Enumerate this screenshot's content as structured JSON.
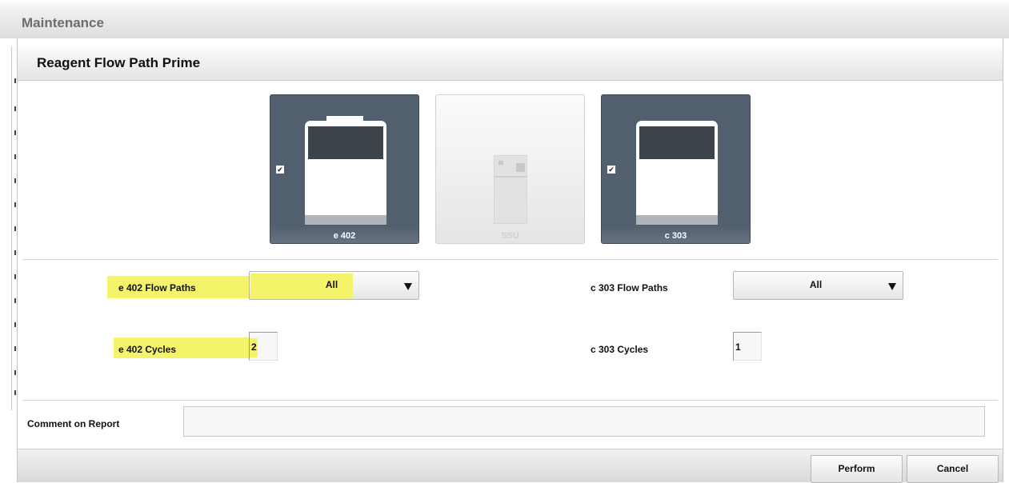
{
  "window": {
    "title": "Maintenance"
  },
  "dialog": {
    "title": "Reagent Flow Path Prime"
  },
  "modules": [
    {
      "label": "e 402",
      "selected": true,
      "enabled": true,
      "check_glyph": "✔"
    },
    {
      "label": "SSU",
      "selected": false,
      "enabled": false
    },
    {
      "label": "c 303",
      "selected": true,
      "enabled": true,
      "check_glyph": "✔"
    }
  ],
  "e402": {
    "flow_paths_label": "e 402 Flow Paths",
    "flow_paths_value": "All",
    "cycles_label": "e 402 Cycles",
    "cycles_value": "2"
  },
  "c303": {
    "flow_paths_label": "c 303 Flow Paths",
    "flow_paths_value": "All",
    "cycles_label": "c 303 Cycles",
    "cycles_value": "1"
  },
  "comment": {
    "label": "Comment on Report",
    "value": ""
  },
  "buttons": {
    "perform": "Perform",
    "cancel": "Cancel"
  },
  "colors": {
    "module_active": "#525f6f",
    "highlight": "#f5f36a"
  }
}
